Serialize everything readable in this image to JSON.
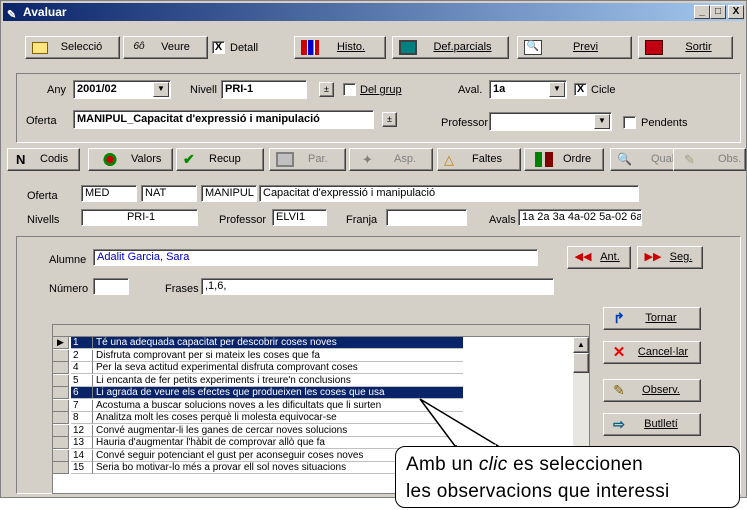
{
  "window": {
    "title": "Avaluar",
    "min": "_",
    "max": "□",
    "close": "X"
  },
  "toolbar1": {
    "seleccio": "Selecció",
    "veure": "Veure",
    "detall": "Detall",
    "detall_checked": "X",
    "histo": "Histo.",
    "defparcials": "Def.parcials",
    "previ": "Previ",
    "sortir": "Sortir"
  },
  "filters": {
    "any_label": "Any",
    "any_value": "2001/02",
    "nivell_label": "Nivell",
    "nivell_value": "PRI-1",
    "del_grup_label": "Del grup",
    "aval_label": "Aval.",
    "aval_value": "1a",
    "cicle_label": "Cicle",
    "cicle_checked": "X",
    "oferta_label": "Oferta",
    "oferta_value": "MANIPUL_Capacitat d'expressió i manipulació",
    "professor_label": "Professor",
    "professor_value": "",
    "pendents_label": "Pendents"
  },
  "toolbar2": {
    "codis": "Codis",
    "valors": "Valors",
    "recup": "Recup",
    "par": "Par.",
    "asp": "Asp.",
    "faltes": "Faltes",
    "ordre": "Ordre",
    "qualif": "Qualif",
    "obs": "Obs."
  },
  "info": {
    "oferta_label": "Oferta",
    "oferta_1": "MED",
    "oferta_2": "NAT",
    "oferta_3": "MANIPUL",
    "oferta_desc": "Capacitat d'expressió i manipulació",
    "nivells_label": "Nivells",
    "nivells_value": "PRI-1",
    "professor_label": "Professor",
    "professor_value": "ELVI1",
    "franja_label": "Franja",
    "franja_value": "",
    "avals_label": "Avals",
    "avals_value": "1a 2a 3a 4a-02 5a-02 6a"
  },
  "student": {
    "alumne_label": "Alumne",
    "alumne_value": "Adalit Garcia, Sara",
    "ant": "Ant.",
    "seg": "Seg.",
    "numero_label": "Número",
    "numero_value": "",
    "frases_label": "Frases",
    "frases_value": ",1,6,"
  },
  "phrases": [
    {
      "n": "1",
      "text": "Té una adequada capacitat per descobrir coses noves",
      "selected": true
    },
    {
      "n": "2",
      "text": "Disfruta comprovant per si mateix les coses que fa",
      "selected": false
    },
    {
      "n": "4",
      "text": "Per la seva actitud experimental disfruta comprovant coses",
      "selected": false
    },
    {
      "n": "5",
      "text": "Li encanta de fer petits experiments i treure'n conclusions",
      "selected": false
    },
    {
      "n": "6",
      "text": "Li agrada de veure els efectes que produeixen les coses que usa",
      "selected": true
    },
    {
      "n": "7",
      "text": "Acostuma a buscar solucions noves a les dificultats que li surten",
      "selected": false
    },
    {
      "n": "8",
      "text": "Analitza molt les coses perquè li molesta equivocar-se",
      "selected": false
    },
    {
      "n": "12",
      "text": "Convé augmentar-li les ganes de cercar noves solucions",
      "selected": false
    },
    {
      "n": "13",
      "text": "Hauria d'augmentar l'hàbit de comprovar allò que fa",
      "selected": false
    },
    {
      "n": "14",
      "text": "Convé seguir potenciant el gust per aconseguir coses noves",
      "selected": false
    },
    {
      "n": "15",
      "text": "Seria bo motivar-lo més a provar ell sol noves situacions",
      "selected": false
    }
  ],
  "side_buttons": {
    "tornar": "Tornar",
    "cancellar": "Cancel·lar",
    "observ": "Observ.",
    "butlleti": "Butlletí"
  },
  "callout": {
    "line1_pre": "Amb un ",
    "line1_em": "clic",
    "line1_post": " es seleccionen",
    "line2": "les observacions que interessi"
  },
  "colors": {
    "titlebar": "#0a246a",
    "selection": "#0a246a",
    "link_text": "#0000c0"
  }
}
